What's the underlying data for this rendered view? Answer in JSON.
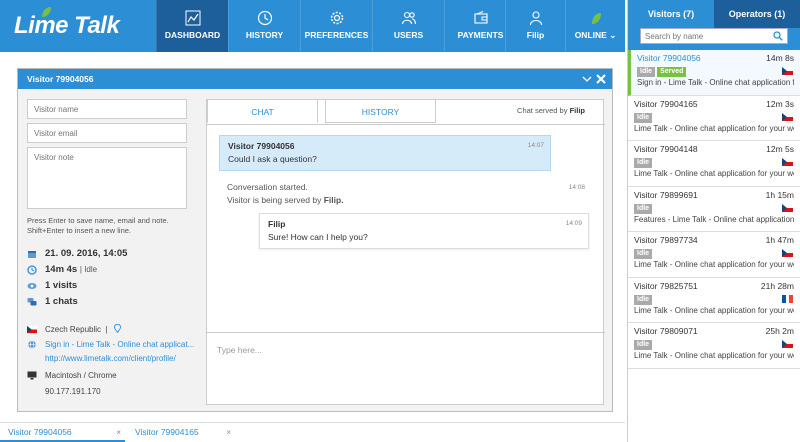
{
  "app": {
    "logo": "Lime Talk"
  },
  "nav": [
    {
      "label": "DASHBOARD",
      "icon": "chart-icon",
      "active": true
    },
    {
      "label": "HISTORY",
      "icon": "clock-icon"
    },
    {
      "label": "PREFERENCES",
      "icon": "gear-icon"
    },
    {
      "label": "USERS",
      "icon": "users-icon"
    },
    {
      "label": "PAYMENTS",
      "icon": "wallet-icon"
    }
  ],
  "user": {
    "name": "Filip",
    "status": "ONLINE"
  },
  "sidebar": {
    "tabs": [
      {
        "label": "Visitors (7)"
      },
      {
        "label": "Operators (1)"
      }
    ],
    "search_placeholder": "Search by name",
    "visitors": [
      {
        "name": "Visitor 79904056",
        "time": "14m 8s",
        "badge1": "Idle",
        "badge2": "Served",
        "page": "Sign in - Lime Talk - Online chat application for your website",
        "flag": "cz"
      },
      {
        "name": "Visitor 79904165",
        "time": "12m 3s",
        "badge1": "Idle",
        "page": "Lime Talk - Online chat application for your website",
        "flag": "cz"
      },
      {
        "name": "Visitor 79904148",
        "time": "12m 5s",
        "badge1": "Idle",
        "page": "Lime Talk - Online chat application for your website",
        "flag": "cz"
      },
      {
        "name": "Visitor 79899691",
        "time": "1h 15m",
        "badge1": "Idle",
        "page": "Features - Lime Talk - Online chat application",
        "flag": "cz"
      },
      {
        "name": "Visitor 79897734",
        "time": "1h 47m",
        "badge1": "Idle",
        "page": "Lime Talk - Online chat application for your website",
        "flag": "cz"
      },
      {
        "name": "Visitor 79825751",
        "time": "21h 28m",
        "badge1": "Idle",
        "page": "Lime Talk - Online chat application for your website",
        "flag": "fr"
      },
      {
        "name": "Visitor 79809071",
        "time": "25h 2m",
        "badge1": "Idle",
        "page": "Lime Talk - Online chat application for your website",
        "flag": "cz"
      }
    ]
  },
  "modal": {
    "title": "Visitor 79904056",
    "name_placeholder": "Visitor name",
    "email_placeholder": "Visitor email",
    "note_placeholder": "Visitor note",
    "hint": "Press Enter to save name, email and note. Shift+Enter to insert a new line.",
    "date": "21. 09. 2016, 14:05",
    "duration": "14m 4s",
    "duration_status": "Idle",
    "visits": "1 visits",
    "chats": "1 chats",
    "country": "Czech Republic",
    "page": "Sign in - Lime Talk - Online chat applicat...",
    "url": "http://www.limetalk.com/client/profile/",
    "browser": "Macintosh / Chrome",
    "ip": "90.177.191.170",
    "chat_tab": "CHAT",
    "history_tab": "HISTORY",
    "served_prefix": "Chat served by",
    "served_by": "Filip",
    "messages": {
      "visitor_name": "Visitor 79904056",
      "visitor_text": "Could I ask a question?",
      "visitor_time": "14:07",
      "system_line1": "Conversation started.",
      "system_line2": "Visitor is being served by",
      "system_op": "Filip.",
      "system_time": "14:08",
      "op_name": "Filip",
      "op_text": "Sure! How can I help you?",
      "op_time": "14:09"
    },
    "type_placeholder": "Type here..."
  },
  "bottom_tabs": [
    {
      "label": "Visitor 79904056"
    },
    {
      "label": "Visitor 79904165"
    }
  ],
  "colors": {
    "primary": "#2c8fd6",
    "primary_dark": "#1c5f9a",
    "lime": "#79c142"
  }
}
